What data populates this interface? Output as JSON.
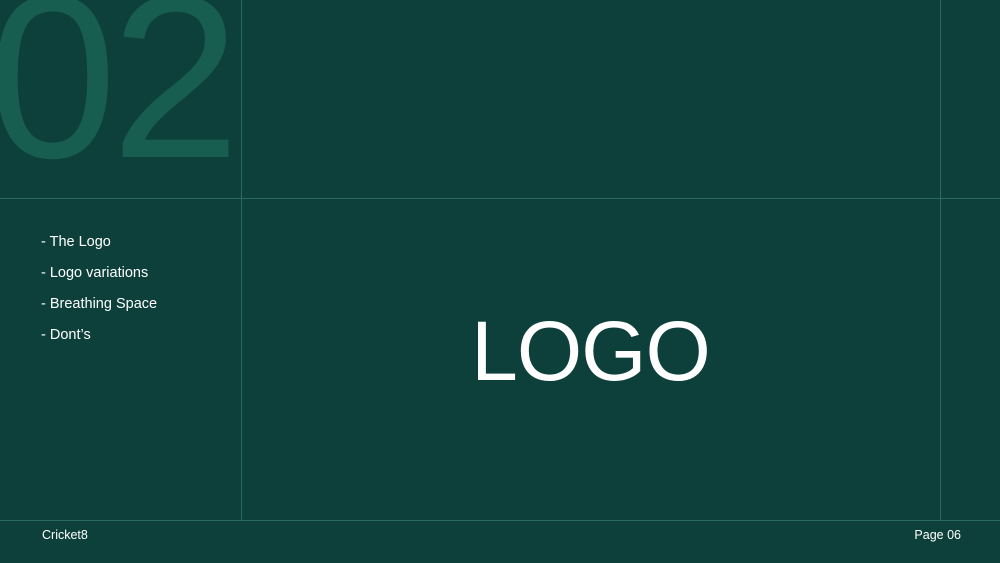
{
  "slide": {
    "section_number": "02",
    "title": "LOGO",
    "toc": [
      "- The Logo",
      "- Logo variations",
      "- Breathing Space",
      "- Dont’s"
    ],
    "footer": {
      "brand": "Cricket8",
      "page": "Page 06"
    }
  },
  "colors": {
    "background": "#0d403a",
    "section_number": "#175e50",
    "grid_lines": "#2a6a5f",
    "text": "#ffffff"
  }
}
